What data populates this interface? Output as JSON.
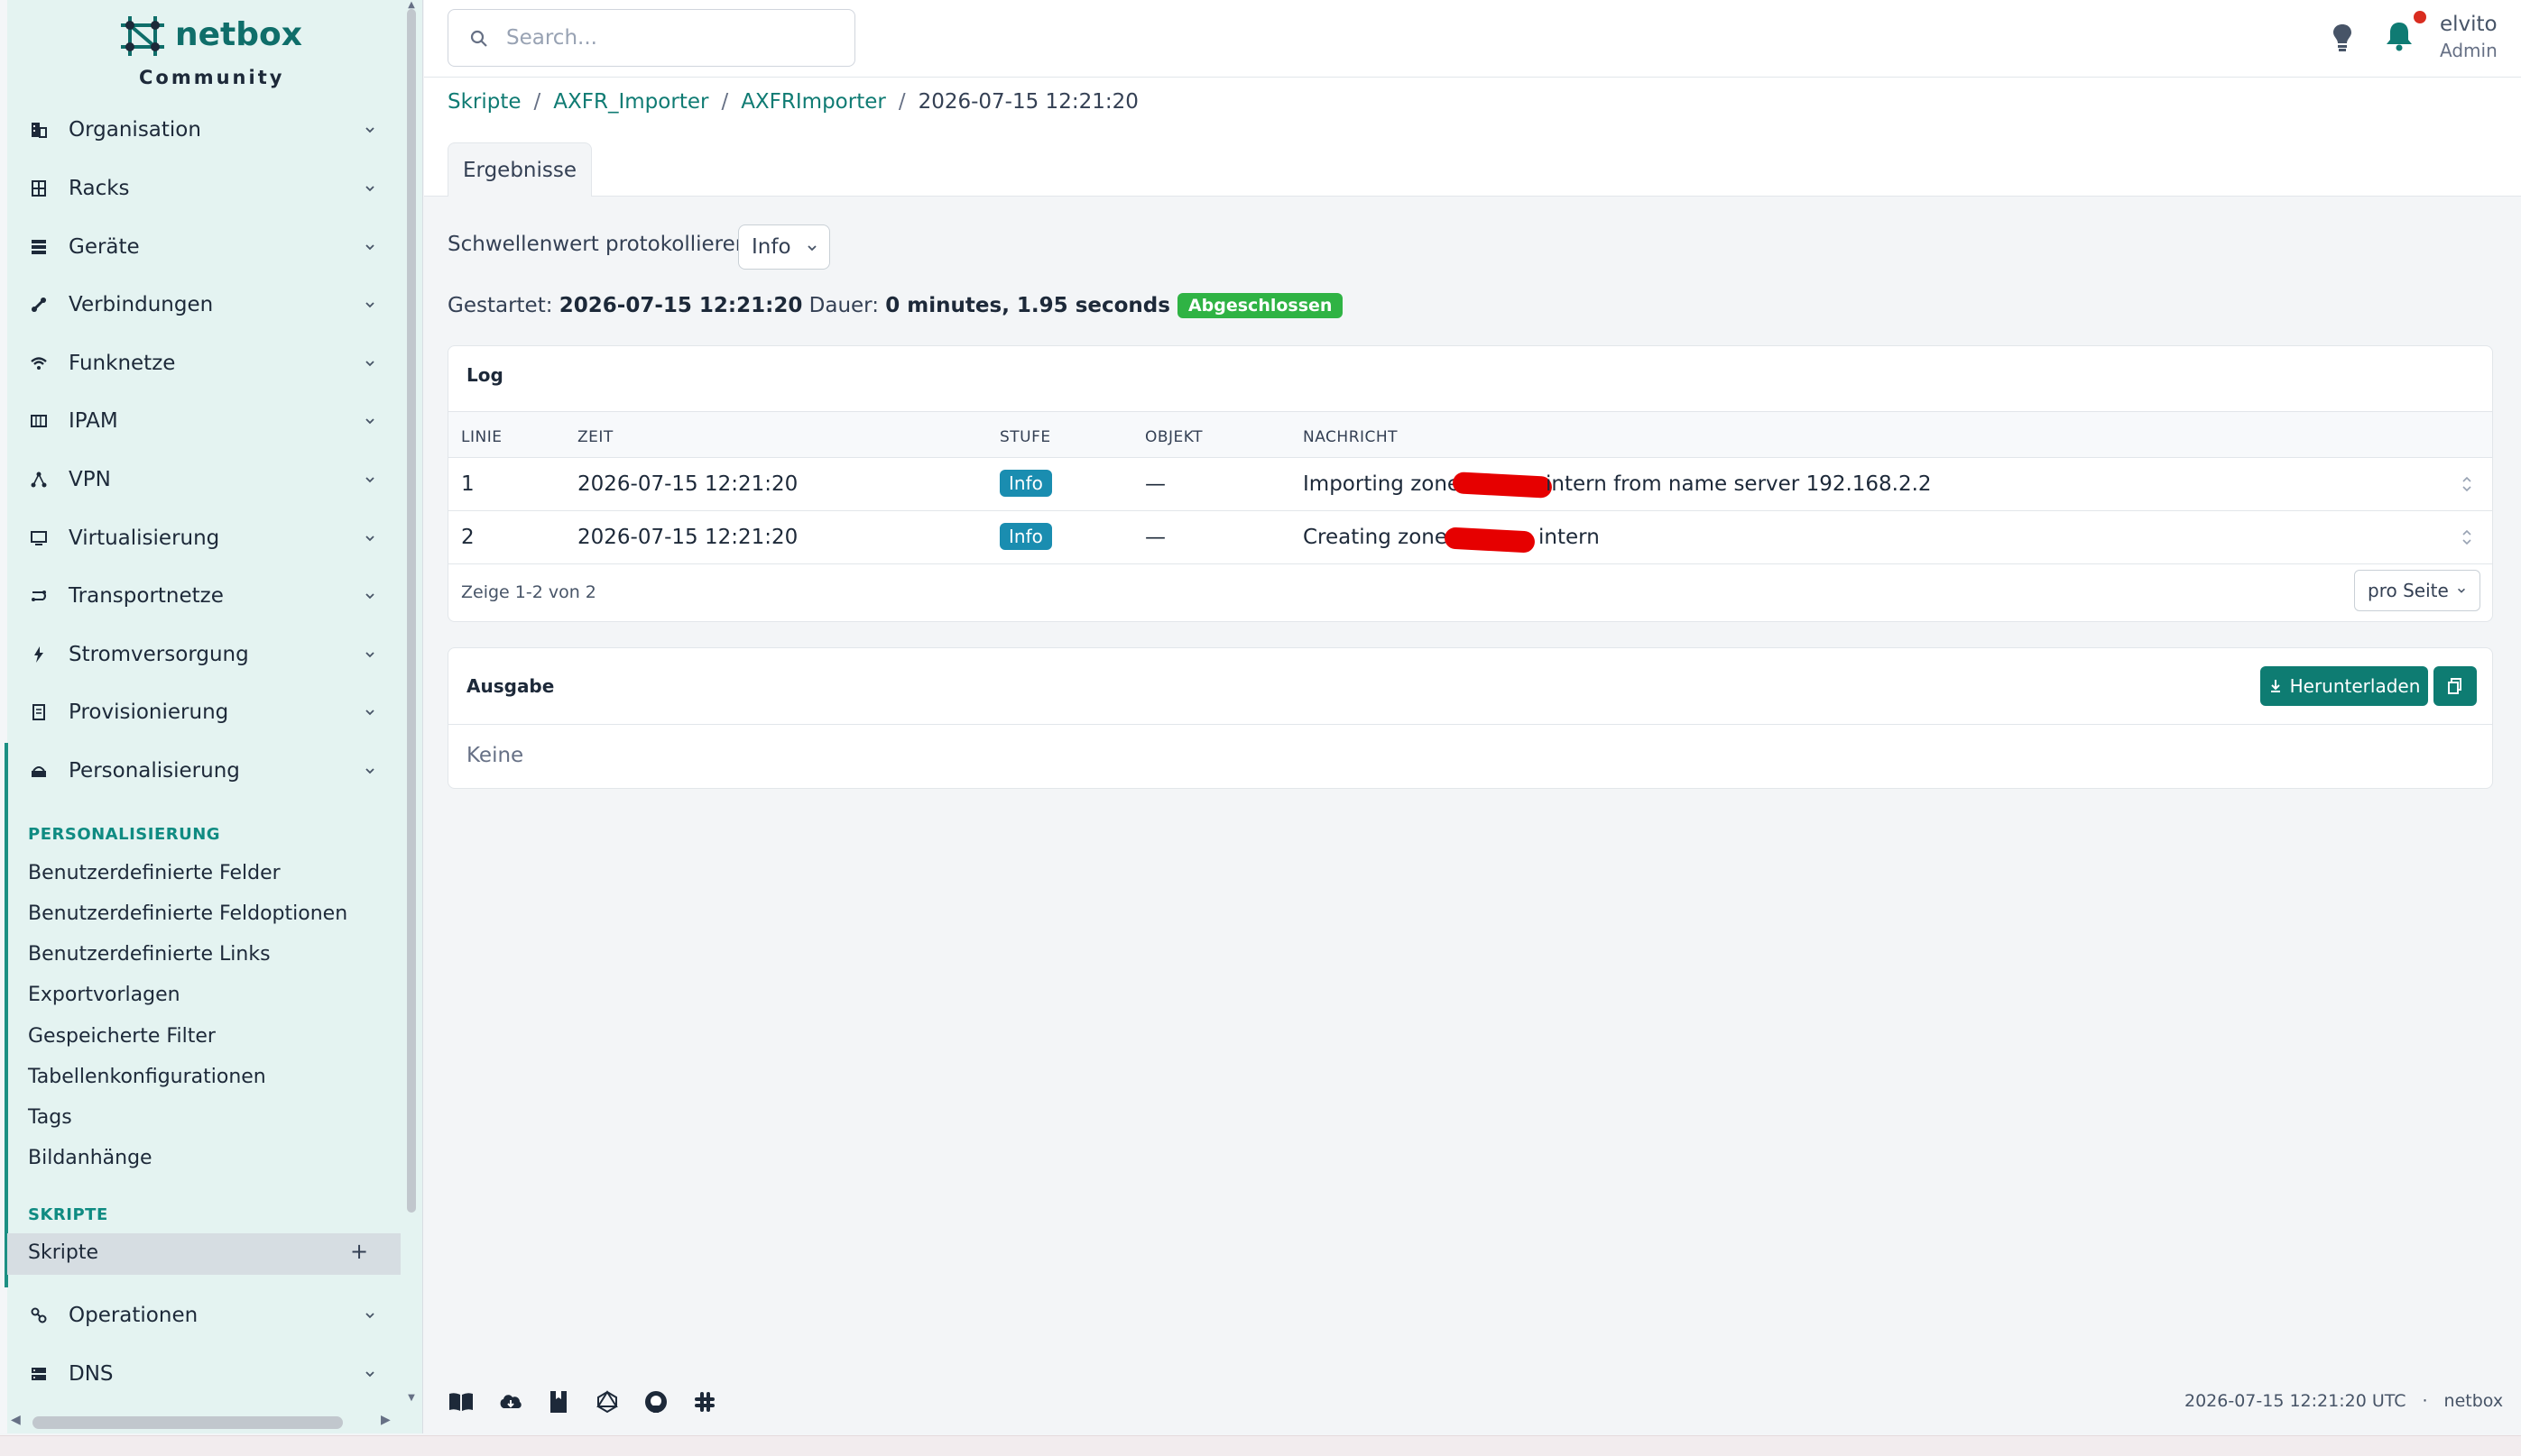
{
  "brand": {
    "name": "netbox",
    "edition": "Community"
  },
  "search": {
    "placeholder": "Search..."
  },
  "user": {
    "name": "elvito",
    "role": "Admin"
  },
  "sidebar": {
    "items": [
      {
        "label": "Organisation",
        "icon": "organization-icon"
      },
      {
        "label": "Racks",
        "icon": "rack-icon"
      },
      {
        "label": "Geräte",
        "icon": "server-icon"
      },
      {
        "label": "Verbindungen",
        "icon": "cable-icon"
      },
      {
        "label": "Funknetze",
        "icon": "wifi-icon"
      },
      {
        "label": "IPAM",
        "icon": "counter-icon"
      },
      {
        "label": "VPN",
        "icon": "vpn-icon"
      },
      {
        "label": "Virtualisierung",
        "icon": "monitor-icon"
      },
      {
        "label": "Transportnetze",
        "icon": "transport-icon"
      },
      {
        "label": "Stromversorgung",
        "icon": "lightning-icon"
      },
      {
        "label": "Provisionierung",
        "icon": "provisioning-icon"
      },
      {
        "label": "Personalisierung",
        "icon": "customization-icon"
      }
    ],
    "personalisierung_heading": "PERSONALISIERUNG",
    "personalisierung_items": [
      "Benutzerdefinierte Felder",
      "Benutzerdefinierte Feldoptionen",
      "Benutzerdefinierte Links",
      "Exportvorlagen",
      "Gespeicherte Filter",
      "Tabellenkonfigurationen",
      "Tags",
      "Bildanhänge"
    ],
    "skripte_heading": "SKRIPTE",
    "skripte_item": "Skripte",
    "bottom_items": [
      {
        "label": "Operationen",
        "icon": "operations-icon"
      },
      {
        "label": "DNS",
        "icon": "dns-icon"
      }
    ]
  },
  "breadcrumb": [
    "Skripte",
    "AXFR_Importer",
    "AXFRImporter",
    "2026-07-15 12:21:20"
  ],
  "tabs": [
    "Ergebnisse"
  ],
  "log_level": {
    "label": "Schwellenwert protokollieren",
    "value": "Info"
  },
  "status": {
    "started_label": "Gestartet:",
    "started_value": "2026-07-15 12:21:20",
    "duration_label": "Dauer:",
    "duration_value": "0 minutes, 1.95 seconds",
    "badge": "Abgeschlossen"
  },
  "log": {
    "title": "Log",
    "columns": [
      "LINIE",
      "ZEIT",
      "STUFE",
      "OBJEKT",
      "NACHRICHT"
    ],
    "rows": [
      {
        "line": "1",
        "time": "2026-07-15 12:21:20",
        "level": "Info",
        "object": "—",
        "msg_a": "Importing zone",
        "msg_b": "intern from name server 192.168.2.2"
      },
      {
        "line": "2",
        "time": "2026-07-15 12:21:20",
        "level": "Info",
        "object": "—",
        "msg_a": "Creating zone",
        "msg_b": "intern"
      }
    ],
    "pager": "Zeige 1-2 von 2",
    "per_page": "pro Seite"
  },
  "output": {
    "title": "Ausgabe",
    "download": "Herunterladen",
    "body": "Keine"
  },
  "footer": {
    "timestamp": "2026-07-15 12:21:20 UTC",
    "separator": "·",
    "brand": "netbox"
  },
  "colors": {
    "accent": "#0e7c72",
    "success": "#2fb344",
    "info": "#1a8db0",
    "redaction": "#e60000"
  }
}
